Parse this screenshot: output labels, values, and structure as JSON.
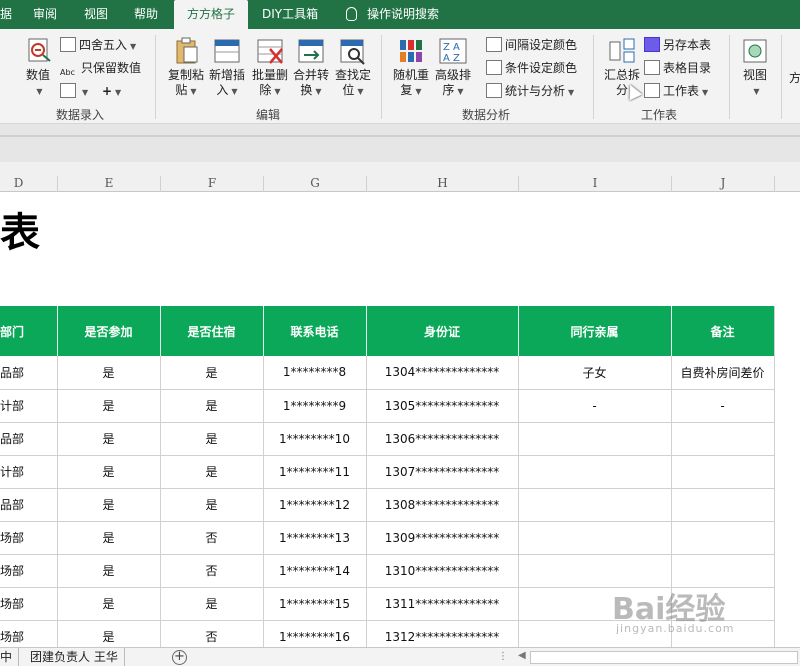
{
  "tabs": [
    "据",
    "审阅",
    "视图",
    "帮助",
    "方方格子",
    "DIY工具箱",
    "操作说明搜索"
  ],
  "active_tab": "方方格子",
  "ribbon": {
    "group_data_entry": {
      "label": "数据录入",
      "numeric": "数值",
      "round": "四舍五入",
      "keep_values": "只保留数值"
    },
    "group_edit": {
      "label": "编辑",
      "copy_paste": [
        "复制粘",
        "贴"
      ],
      "insert": [
        "新增插",
        "入"
      ],
      "batch_delete": [
        "批量删",
        "除"
      ],
      "merge_convert": [
        "合并转",
        "换"
      ],
      "find_locate": [
        "查找定",
        "位"
      ]
    },
    "group_analysis": {
      "label": "数据分析",
      "random_reorder": [
        "随机重",
        "复"
      ],
      "advanced_sort": [
        "高级排",
        "序"
      ],
      "interval_color": "间隔设定颜色",
      "conditional_color": "条件设定颜色",
      "stats": "统计与分析"
    },
    "group_worksheet": {
      "label": "工作表",
      "summarize_split": [
        "汇总拆",
        "分"
      ],
      "save_sheet": "另存本表",
      "sheet_index": "表格目录",
      "worksheet": "工作表"
    },
    "view": "视图",
    "extra": "方"
  },
  "columns": [
    "D",
    "E",
    "F",
    "G",
    "H",
    "I",
    "J"
  ],
  "title_text": "表",
  "table": {
    "headers": [
      "部门",
      "是否参加",
      "是否住宿",
      "联系电话",
      "身份证",
      "同行亲属",
      "备注"
    ],
    "rows": [
      [
        "品部",
        "是",
        "是",
        "1********8",
        "1304**************",
        "子女",
        "自费补房间差价"
      ],
      [
        "计部",
        "是",
        "是",
        "1********9",
        "1305**************",
        "-",
        "-"
      ],
      [
        "品部",
        "是",
        "是",
        "1********10",
        "1306**************",
        "",
        ""
      ],
      [
        "计部",
        "是",
        "是",
        "1********11",
        "1307**************",
        "",
        ""
      ],
      [
        "品部",
        "是",
        "是",
        "1********12",
        "1308**************",
        "",
        ""
      ],
      [
        "场部",
        "是",
        "否",
        "1********13",
        "1309**************",
        "",
        ""
      ],
      [
        "场部",
        "是",
        "否",
        "1********14",
        "1310**************",
        "",
        ""
      ],
      [
        "场部",
        "是",
        "是",
        "1********15",
        "1311**************",
        "",
        ""
      ],
      [
        "场部",
        "是",
        "否",
        "1********16",
        "1312**************",
        "",
        ""
      ]
    ]
  },
  "sheet_tabs": [
    "中",
    "团建负责人 王华"
  ],
  "add_sheet": "+",
  "watermark": {
    "brand": "Bai经验",
    "sub": "jingyan.baidu.com"
  },
  "colors": {
    "excel_green": "#217346",
    "header_green": "#0aa858"
  }
}
